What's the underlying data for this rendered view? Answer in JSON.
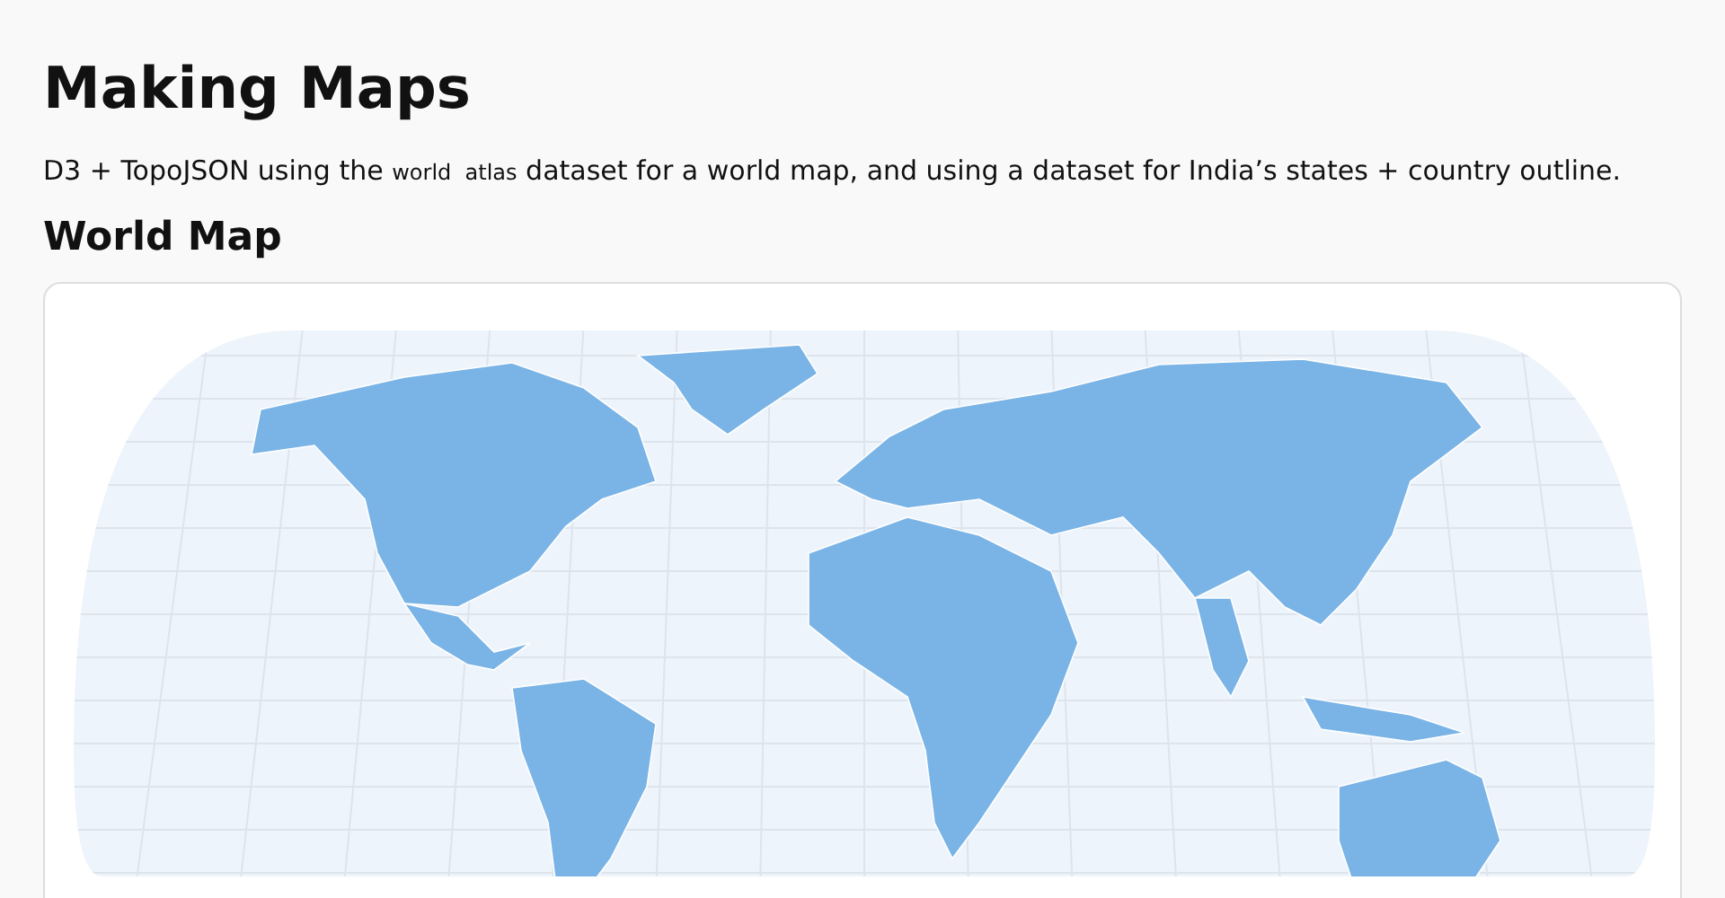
{
  "title": "Making Maps",
  "intro": {
    "before": "D3 + TopoJSON using the",
    "code": "world  atlas",
    "after": "dataset for a world map, and using a dataset for India’s states + country outline."
  },
  "section": {
    "heading": "World Map"
  }
}
